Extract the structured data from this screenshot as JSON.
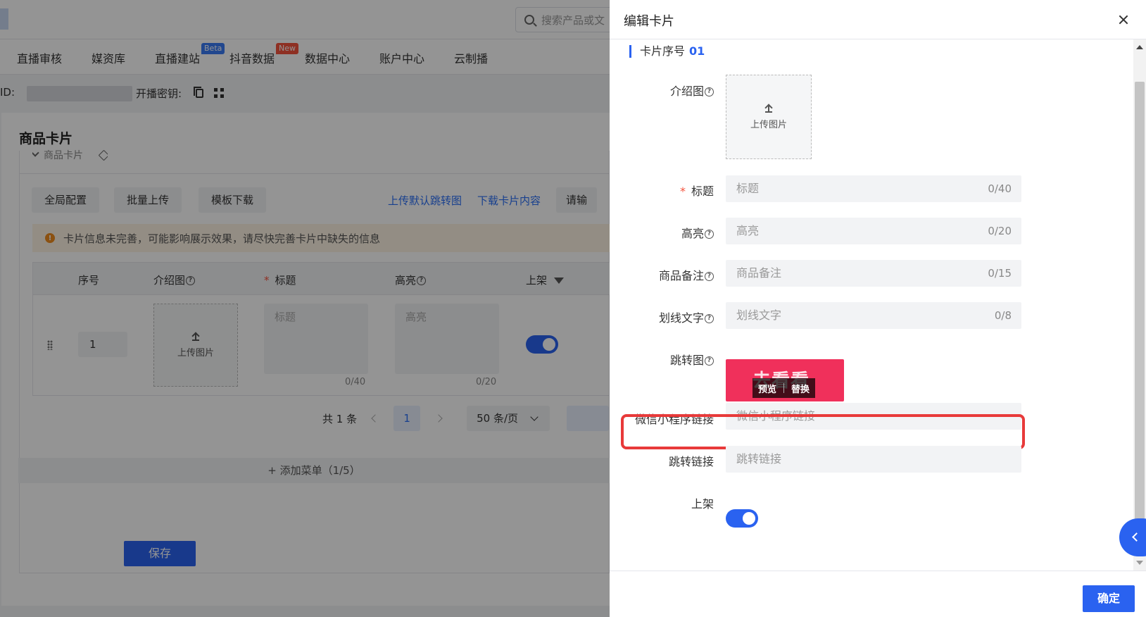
{
  "topbar": {
    "search_placeholder": "搜索产品或文"
  },
  "nav": {
    "items": [
      "直播审核",
      "媒资库",
      "直播建站",
      "抖音数据",
      "数据中心",
      "账户中心",
      "云制播"
    ],
    "badges": {
      "beta": "Beta",
      "new": "New"
    }
  },
  "idrow": {
    "id_label": "ID:",
    "key_label": "开播密钥:"
  },
  "card": {
    "title": "商品卡片",
    "sub_title": "商品卡片",
    "buttons": [
      "全局配置",
      "批量上传",
      "模板下载"
    ],
    "links": [
      "上传默认跳转图",
      "下载卡片内容",
      "请输"
    ],
    "alert": "卡片信息未完善，可能影响展示效果，请尽快完善卡片中缺失的信息",
    "table": {
      "headers": [
        "序号",
        "介绍图",
        "标题",
        "高亮",
        "上架"
      ],
      "row": {
        "index": "1",
        "upload_label": "上传图片",
        "title_placeholder": "标题",
        "title_count": "0/40",
        "highlight_placeholder": "高亮",
        "highlight_count": "0/20",
        "listed": true
      }
    },
    "pager": {
      "total": "共 1 条",
      "current": "1",
      "page_size": "50 条/页"
    },
    "add_menu": "+ 添加菜单（1/5）",
    "save": "保存"
  },
  "drawer": {
    "title": "编辑卡片",
    "section_label": "卡片序号",
    "section_number": "01",
    "fields": {
      "intro_image": {
        "label": "介绍图",
        "upload_label": "上传图片"
      },
      "title": {
        "label": "标题",
        "placeholder": "标题",
        "count": "0/40"
      },
      "highlight": {
        "label": "高亮",
        "placeholder": "高亮",
        "count": "0/20"
      },
      "remark": {
        "label": "商品备注",
        "placeholder": "商品备注",
        "count": "0/15"
      },
      "strike_text": {
        "label": "划线文字",
        "placeholder": "划线文字",
        "count": "0/8"
      },
      "jump_image": {
        "label": "跳转图",
        "image_text": "去看看",
        "preview": "预览",
        "replace": "替换"
      },
      "wechat_link": {
        "label": "微信小程序链接",
        "placeholder": "微信小程序链接"
      },
      "jump_link": {
        "label": "跳转链接",
        "placeholder": "跳转链接"
      },
      "listed": {
        "label": "上架",
        "on": true
      }
    },
    "confirm": "确定"
  },
  "colors": {
    "primary": "#2a62f0",
    "highlight_border": "#e83a3a",
    "jump_image_bg": "#f0305b"
  }
}
